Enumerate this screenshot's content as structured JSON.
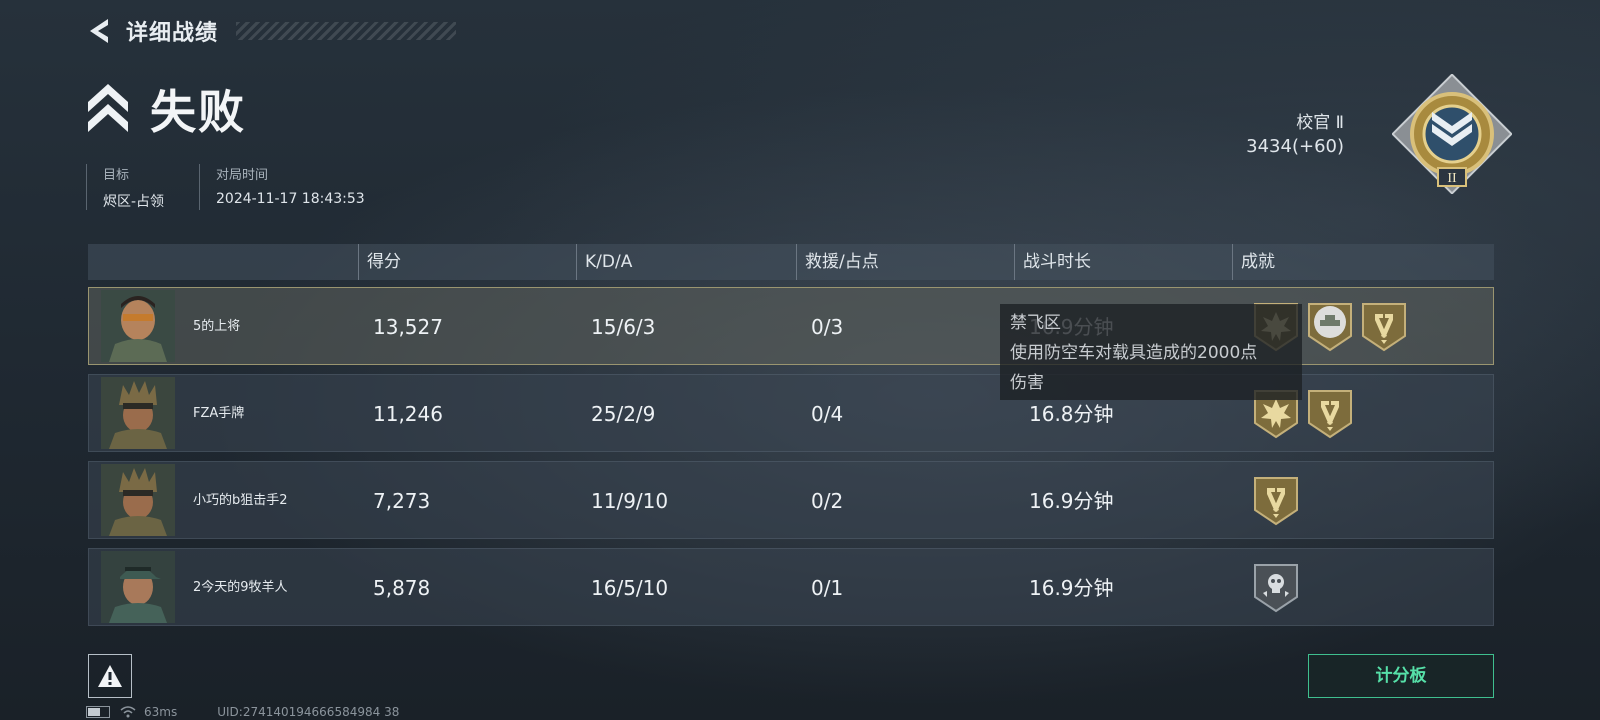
{
  "header": {
    "back_title": "详细战绩",
    "result": "失败",
    "target_label": "目标",
    "target_value": "烬区-占领",
    "time_label": "对局时间",
    "time_value": "2024-11-17 18:43:53"
  },
  "rank": {
    "name": "校官 Ⅱ",
    "points": "3434(+60)",
    "badge_numeral": "II"
  },
  "table": {
    "columns": [
      "得分",
      "K/D/A",
      "救援/占点",
      "战斗时长",
      "成就"
    ],
    "rows": [
      {
        "name": "5的上将",
        "score": "13,527",
        "kda": "15/6/3",
        "rescue": "0/3",
        "duration": "16.9分钟",
        "achievements": [
          "explosion-medal-icon",
          "vehicle-medal-icon",
          "hammer-medal-icon"
        ]
      },
      {
        "name": "FZA手牌",
        "score": "11,246",
        "kda": "25/2/9",
        "rescue": "0/4",
        "duration": "16.8分钟",
        "achievements": [
          "explosion-medal-icon",
          "hammer-medal-icon"
        ]
      },
      {
        "name": "小巧的b狙击手2",
        "score": "7,273",
        "kda": "11/9/10",
        "rescue": "0/2",
        "duration": "16.9分钟",
        "achievements": [
          "hammer-medal-icon"
        ]
      },
      {
        "name": "2今天的9牧羊人",
        "score": "5,878",
        "kda": "16/5/10",
        "rescue": "0/1",
        "duration": "16.9分钟",
        "achievements": [
          "skull-medal-icon"
        ]
      }
    ]
  },
  "tooltip": {
    "title": "禁飞区",
    "description_line1": "使用防空车对载具造成的2000点",
    "description_line2": "伤害"
  },
  "footer": {
    "scoreboard_label": "计分板",
    "ping": "63ms",
    "uid": "UID:274140194666584984 38",
    "battery_level": 0.6
  },
  "colors": {
    "accent_green": "#56e0a8",
    "gold": "#b8a468",
    "highlight_border": "#9a9570"
  }
}
